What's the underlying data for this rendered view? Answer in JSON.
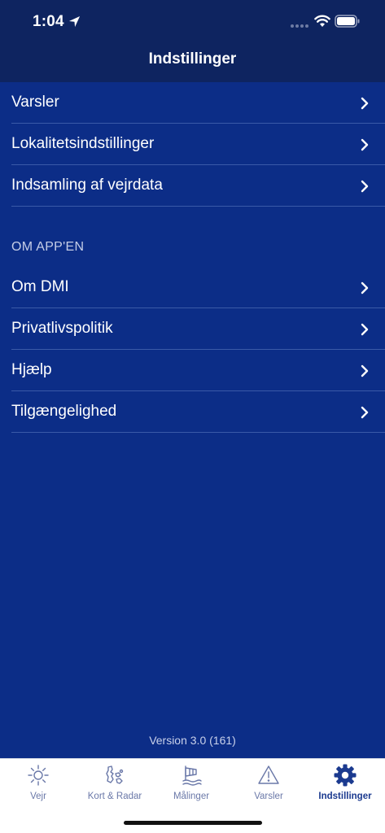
{
  "status_bar": {
    "time": "1:04"
  },
  "header": {
    "title": "Indstillinger"
  },
  "settings_items": [
    {
      "label": "Varsler"
    },
    {
      "label": "Lokalitetsindstillinger"
    },
    {
      "label": "Indsamling af vejrdata"
    }
  ],
  "about_section": {
    "title": "OM APP'EN",
    "items": [
      {
        "label": "Om DMI"
      },
      {
        "label": "Privatlivspolitik"
      },
      {
        "label": "Hjælp"
      },
      {
        "label": "Tilgængelighed"
      }
    ]
  },
  "version": "Version 3.0 (161)",
  "tabbar": {
    "tabs": [
      {
        "label": "Vejr",
        "icon": "sun-icon"
      },
      {
        "label": "Kort & Radar",
        "icon": "map-radar-icon"
      },
      {
        "label": "Målinger",
        "icon": "windsock-icon"
      },
      {
        "label": "Varsler",
        "icon": "warning-icon"
      },
      {
        "label": "Indstillinger",
        "icon": "gear-icon"
      }
    ],
    "active_index": 4
  },
  "colors": {
    "background": "#0c2d87",
    "header": "#0e2460",
    "tab_active": "#1b3a8f",
    "tab_inactive": "#6a78a8"
  }
}
